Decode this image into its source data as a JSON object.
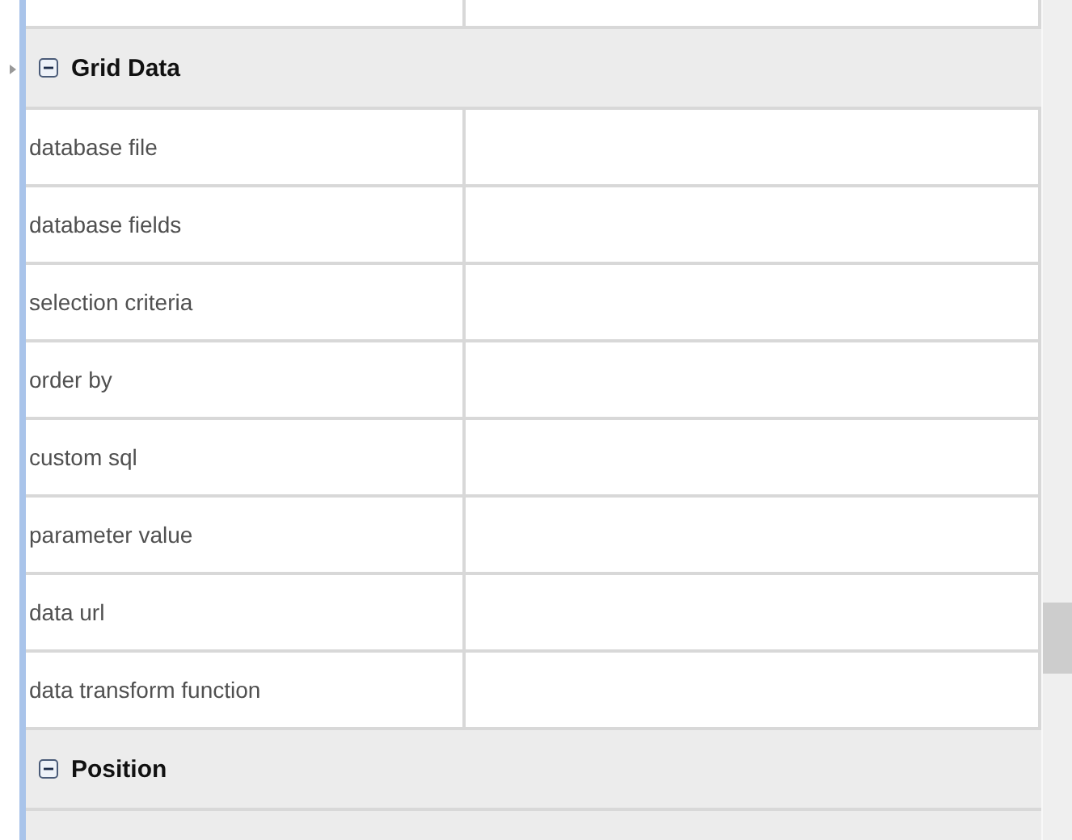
{
  "sections": [
    {
      "title": "Grid Data",
      "expanded": true,
      "properties": [
        {
          "label": "database file"
        },
        {
          "label": "database fields"
        },
        {
          "label": "selection criteria"
        },
        {
          "label": "order by"
        },
        {
          "label": "custom sql"
        },
        {
          "label": "parameter value"
        },
        {
          "label": "data url"
        },
        {
          "label": "data transform function"
        }
      ]
    },
    {
      "title": "Position",
      "expanded": true
    }
  ]
}
